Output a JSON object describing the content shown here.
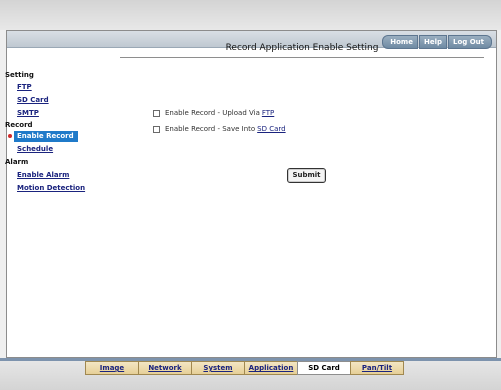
{
  "topnav": {
    "home": "Home",
    "help": "Help",
    "logout": "Log Out"
  },
  "sidebar": {
    "setting": "Setting",
    "ftp": "FTP",
    "sd_card": "SD Card",
    "smtp": "SMTP",
    "record": "Record",
    "enable_record": "Enable Record",
    "schedule": "Schedule",
    "alarm": "Alarm",
    "enable_alarm": "Enable Alarm",
    "motion_detection": "Motion Detection"
  },
  "main": {
    "title": "Record Application Enable Setting",
    "option1": {
      "text": "Enable Record - Upload Via",
      "link": "FTP",
      "checked": false
    },
    "option2": {
      "text": "Enable Record - Save Into",
      "link": "SD Card",
      "checked": false
    },
    "submit": "Submit"
  },
  "tabs": [
    {
      "label": "Image"
    },
    {
      "label": "Network"
    },
    {
      "label": "System"
    },
    {
      "label": "Application"
    },
    {
      "label": "SD Card"
    },
    {
      "label": "Pan/Tilt"
    }
  ]
}
